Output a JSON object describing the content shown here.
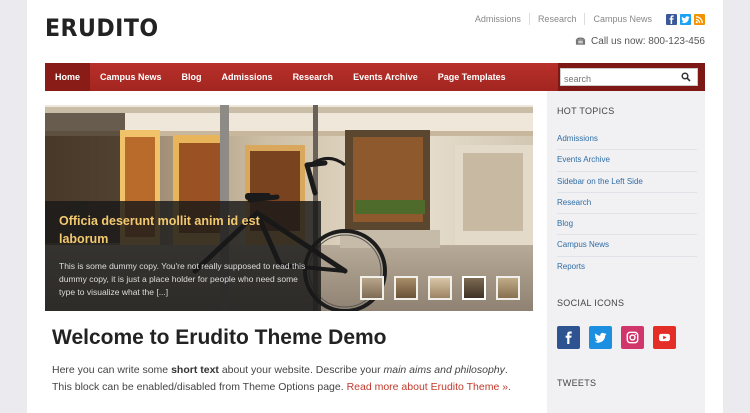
{
  "brand": {
    "logo": "ERUDITO"
  },
  "top_links": [
    "Admissions",
    "Research",
    "Campus News"
  ],
  "social_icons_small": [
    {
      "icon": "facebook-icon",
      "color": "#3b5998"
    },
    {
      "icon": "twitter-icon",
      "color": "#1da1f2"
    },
    {
      "icon": "rss-icon",
      "color": "#f39200"
    }
  ],
  "contact": {
    "call": "Call us now: 800-123-456"
  },
  "nav": {
    "items": [
      "Home",
      "Campus News",
      "Blog",
      "Admissions",
      "Research",
      "Events Archive",
      "Page Templates"
    ],
    "active": "Home",
    "search_placeholder": "search"
  },
  "slider": {
    "title": "Officia deserunt mollit anim id est laborum",
    "text": "This is some dummy copy. You're not really supposed to read this dummy copy, it is just a place holder for people who need some type to visualize what the [...]",
    "thumb_count": 5,
    "active_thumb_index": 3
  },
  "main": {
    "heading": "Welcome to Erudito Theme Demo",
    "intro_a": "Here you can write some ",
    "intro_bold": "short text",
    "intro_b": " about your website. Describe your ",
    "intro_italic": "main aims and philosophy",
    "intro_c": ". This block can be enabled/disabled from Theme Options page. ",
    "read_more": "Read more about Erudito Theme »."
  },
  "sidebar": {
    "hot_topics_title": "HOT TOPICS",
    "topics": [
      "Admissions",
      "Events Archive",
      "Sidebar on the Left Side",
      "Research",
      "Blog",
      "Campus News",
      "Reports"
    ],
    "social_title": "SOCIAL ICONS",
    "social_icons": [
      {
        "icon": "facebook-icon",
        "color": "#2d5391"
      },
      {
        "icon": "twitter-icon",
        "color": "#1d8fe0"
      },
      {
        "icon": "instagram-icon",
        "color": "#d1366b"
      },
      {
        "icon": "youtube-icon",
        "color": "#e52d27"
      }
    ],
    "tweets_title": "TWEETS"
  },
  "colors": {
    "nav": "#a32520",
    "accent_link": "#c0392b",
    "caption_title": "#f3c96f",
    "sidebar_link": "#2e6da4"
  }
}
